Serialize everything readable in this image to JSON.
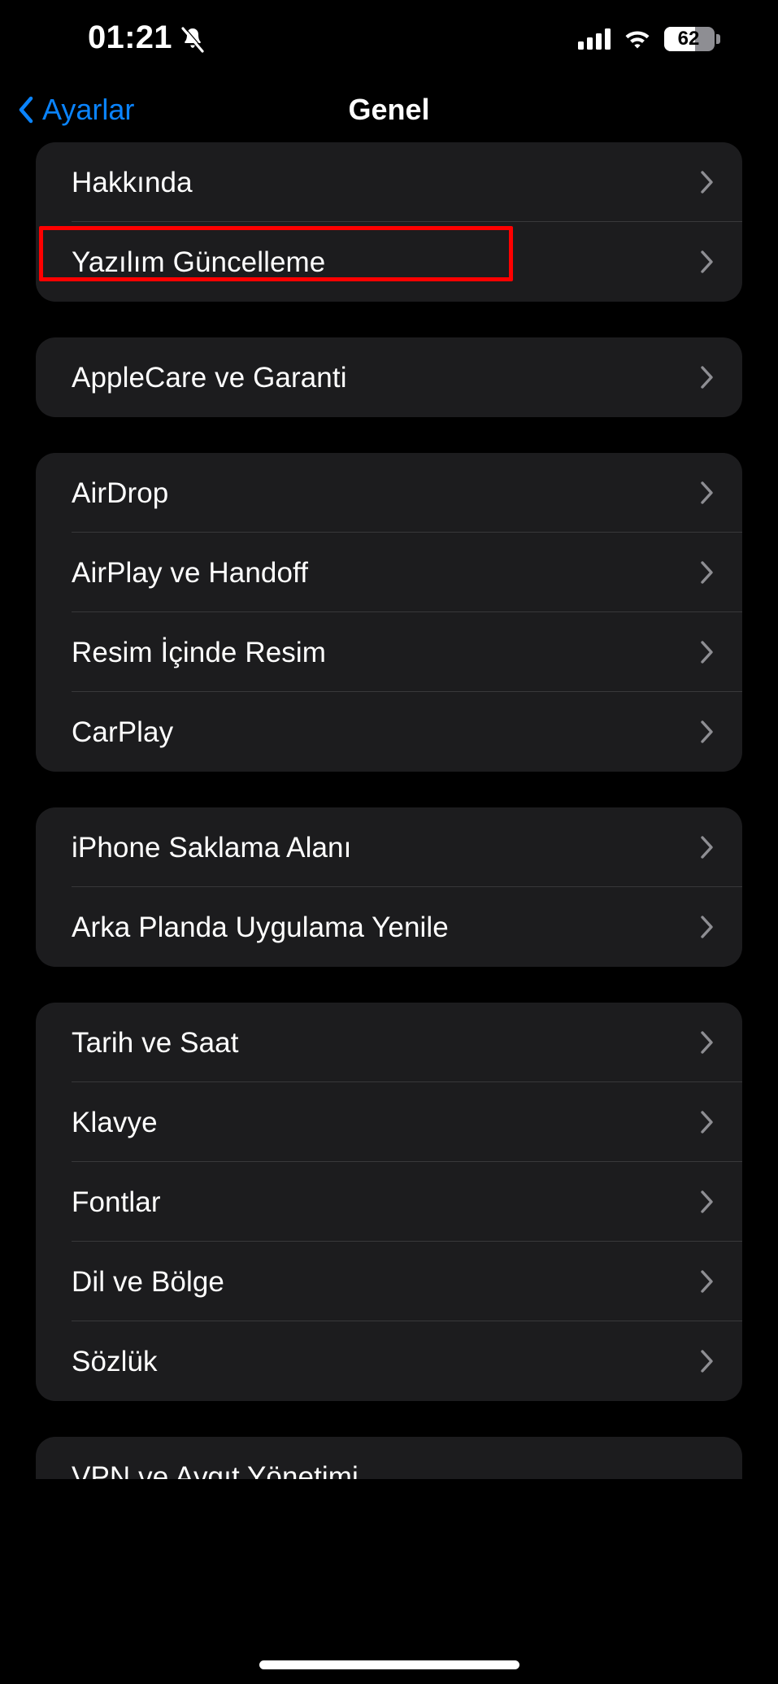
{
  "status_bar": {
    "time": "01:21",
    "silent_icon": "bell-slash-icon",
    "cellular_icon": "cellular-bars-icon",
    "wifi_icon": "wifi-icon",
    "battery_percent": "62",
    "battery_level": 62
  },
  "nav": {
    "back_label": "Ayarlar",
    "back_icon": "chevron-left-icon",
    "title": "Genel"
  },
  "colors": {
    "accent_blue": "#0a84ff",
    "background": "#000000",
    "card": "#1c1c1e",
    "separator": "#38383a",
    "highlight_red": "#ff0000",
    "chevron_gray": "#8e8e93"
  },
  "groups": [
    {
      "rows": [
        {
          "label": "Hakkında",
          "highlighted": false
        },
        {
          "label": "Yazılım Güncelleme",
          "highlighted": true
        }
      ]
    },
    {
      "rows": [
        {
          "label": "AppleCare ve Garanti",
          "highlighted": false
        }
      ]
    },
    {
      "rows": [
        {
          "label": "AirDrop",
          "highlighted": false
        },
        {
          "label": "AirPlay ve Handoff",
          "highlighted": false
        },
        {
          "label": "Resim İçinde Resim",
          "highlighted": false
        },
        {
          "label": "CarPlay",
          "highlighted": false
        }
      ]
    },
    {
      "rows": [
        {
          "label": "iPhone Saklama Alanı",
          "highlighted": false
        },
        {
          "label": "Arka Planda Uygulama Yenile",
          "highlighted": false
        }
      ]
    },
    {
      "rows": [
        {
          "label": "Tarih ve Saat",
          "highlighted": false
        },
        {
          "label": "Klavye",
          "highlighted": false
        },
        {
          "label": "Fontlar",
          "highlighted": false
        },
        {
          "label": "Dil ve Bölge",
          "highlighted": false
        },
        {
          "label": "Sözlük",
          "highlighted": false
        }
      ]
    }
  ],
  "partial_group": {
    "rows": [
      {
        "label": "VPN ve Aygıt Yönetimi",
        "highlighted": false
      }
    ]
  }
}
